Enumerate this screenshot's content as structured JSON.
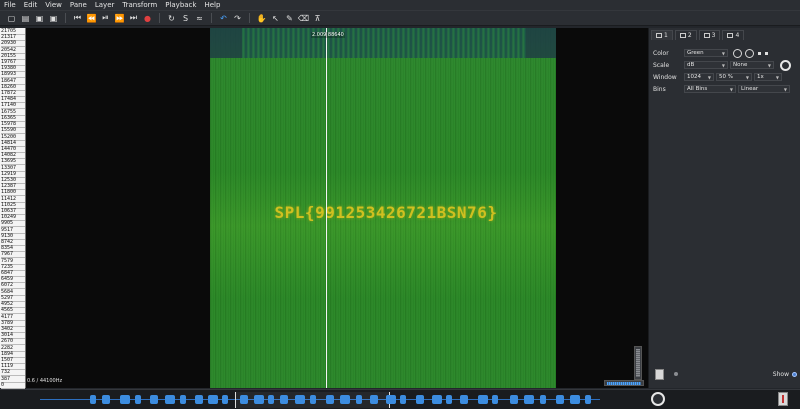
{
  "menu": [
    "File",
    "Edit",
    "View",
    "Pane",
    "Layer",
    "Transform",
    "Playback",
    "Help"
  ],
  "toolbar": {
    "icons": [
      "new-session-icon",
      "open-icon",
      "save-icon",
      "save-as-icon",
      "rewind-start-icon",
      "rewind-icon",
      "play-pause-icon",
      "fast-forward-icon",
      "fast-forward-end-icon",
      "record-icon",
      "loop-icon",
      "solo-icon",
      "play-selection-icon",
      "undo-icon",
      "redo-icon",
      "navigate-icon",
      "select-icon",
      "draw-icon",
      "erase-icon",
      "measure-icon"
    ]
  },
  "scale_ticks": [
    "21705",
    "21317",
    "20930",
    "20542",
    "20155",
    "19767",
    "19380",
    "18993",
    "18647",
    "18260",
    "17872",
    "17484",
    "17140",
    "16755",
    "16365",
    "15978",
    "15590",
    "15200",
    "14814",
    "14470",
    "14082",
    "13695",
    "13307",
    "12919",
    "12530",
    "12387",
    "11800",
    "11412",
    "11025",
    "10637",
    "10249",
    "9905",
    "9517",
    "9130",
    "8742",
    "8354",
    "7967",
    "7579",
    "7235",
    "6847",
    "6459",
    "6072",
    "5684",
    "5297",
    "4952",
    "4565",
    "4177",
    "3789",
    "3402",
    "3014",
    "2670",
    "2282",
    "1894",
    "1507",
    "1119",
    "732",
    "387",
    "0"
  ],
  "spectrogram": {
    "hidden_text": "SPL{991253426721BSN76}",
    "cursor_time": "2.009",
    "cursor_freq": "88640",
    "freq_info": "0.6 / 44100Hz"
  },
  "panel": {
    "tabs": [
      "1",
      "2",
      "3",
      "4"
    ],
    "color_label": "Color",
    "color_value": "Green",
    "scale_label": "Scale",
    "scale_value": "dB",
    "scale_value2": "None",
    "window_label": "Window",
    "window_size": "1024",
    "window_overlap": "50 %",
    "window_zoom": "1x",
    "bins_label": "Bins",
    "bins_value": "All Bins",
    "bins_value2": "Linear",
    "show_label": "Show"
  },
  "colors": {
    "spectrogram_green": "#2a8a26",
    "flag_yellow": "#d0c020",
    "accent_blue": "#3c8cdf"
  }
}
